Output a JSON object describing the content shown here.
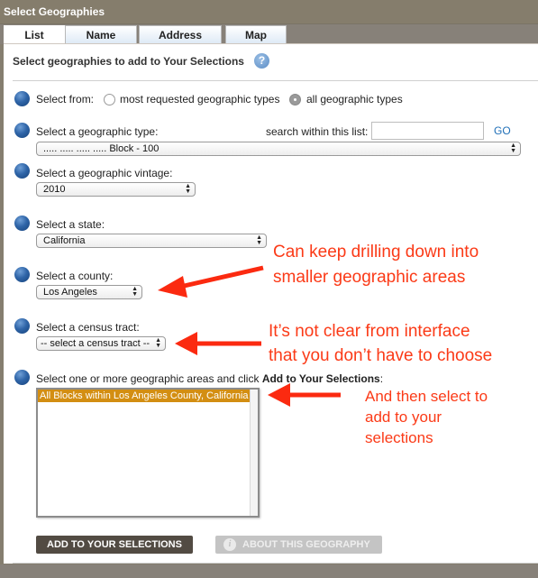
{
  "window": {
    "title": "Select Geographies"
  },
  "tabs": [
    {
      "label": "List",
      "active": true
    },
    {
      "label": "Name",
      "active": false
    },
    {
      "label": "Address",
      "active": false
    },
    {
      "label": "Map",
      "active": false
    }
  ],
  "panel": {
    "heading": "Select geographies to add to Your Selections",
    "help_icon": "question-mark-icon"
  },
  "select_from": {
    "label": "Select from:",
    "options": [
      {
        "label": "most requested geographic types",
        "checked": false
      },
      {
        "label": "all geographic types",
        "checked": true
      }
    ]
  },
  "geo_type": {
    "label": "Select a geographic type:",
    "search_label": "search within this list:",
    "search_value": "",
    "go_label": "GO",
    "selected": "..... ..... ..... ..... Block - 100"
  },
  "vintage": {
    "label": "Select a geographic vintage:",
    "selected": "2010"
  },
  "state": {
    "label": "Select a state:",
    "selected": "California"
  },
  "county": {
    "label": "Select a county:",
    "selected": "Los Angeles"
  },
  "tract": {
    "label": "Select a census tract:",
    "selected": "-- select a census tract --"
  },
  "areas": {
    "label_prefix": "Select one or more geographic areas and click ",
    "label_bold": "Add to Your Selections",
    "label_suffix": ":",
    "options": [
      {
        "label": "All Blocks within Los Angeles County, California",
        "selected": true
      }
    ]
  },
  "buttons": {
    "add": "ADD TO YOUR SELECTIONS",
    "about": "ABOUT THIS GEOGRAPHY"
  },
  "annotations": {
    "drill_line1": "Can keep drilling down into",
    "drill_line2": "smaller geographic areas",
    "tract_line1": "It’s not clear from interface",
    "tract_line2": "that you don’t have to choose",
    "select_line1": "And then select to",
    "select_line2": "add to your",
    "select_line3": "selections",
    "color": "#fb3a17"
  },
  "colors": {
    "title_bar": "#857d6c",
    "primary_button": "#524b43",
    "selected_option": "#d38e12",
    "go_link": "#2170b8"
  }
}
